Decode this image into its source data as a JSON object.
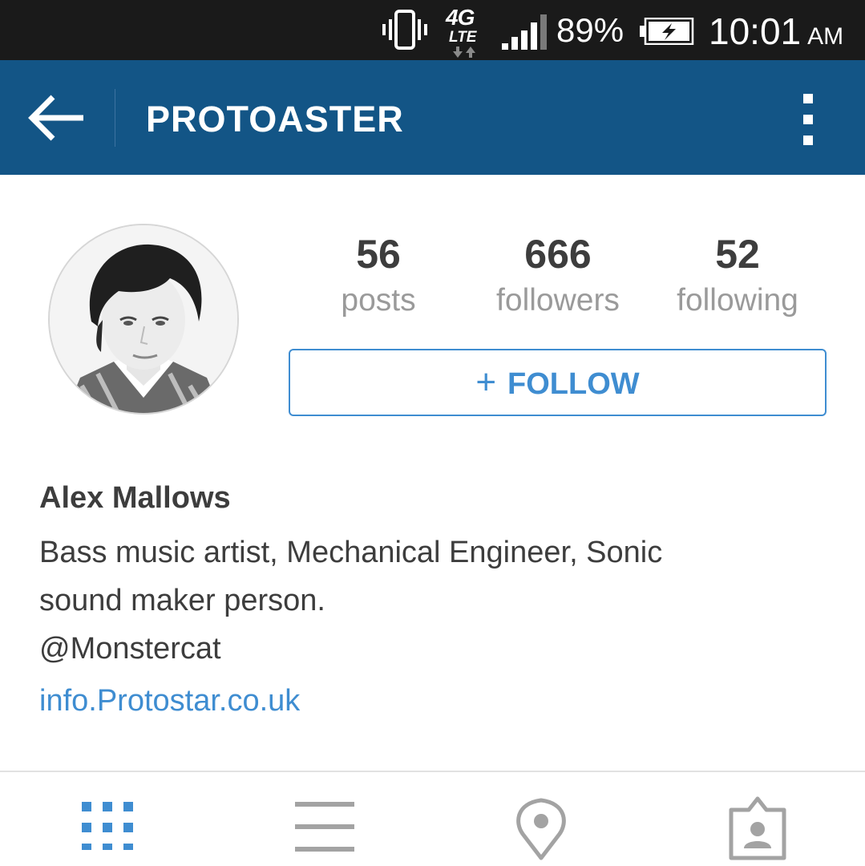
{
  "status_bar": {
    "network_top": "4G",
    "network_bottom": "LTE",
    "battery_percent": "89%",
    "time": "10:01",
    "ampm": "AM",
    "icons": [
      "vibrate-icon",
      "network-arrows-icon",
      "signal-icon",
      "battery-charging-icon"
    ]
  },
  "app_bar": {
    "title": "PROTOASTER",
    "back_icon": "arrow-left-icon",
    "menu_icon": "overflow-menu-icon",
    "background": "#135586"
  },
  "profile": {
    "avatar_icon": "profile-photo",
    "stats": [
      {
        "value": "56",
        "label": "posts"
      },
      {
        "value": "666",
        "label": "followers"
      },
      {
        "value": "52",
        "label": "following"
      }
    ],
    "follow_button": {
      "plus": "+",
      "label": "FOLLOW"
    },
    "name": "Alex Mallows",
    "bio_lines": [
      "Bass music artist, Mechanical Engineer, Sonic",
      "sound maker person.",
      "@Monstercat"
    ],
    "link": "info.Protostar.co.uk"
  },
  "tabs": [
    {
      "icon": "grid-view-icon",
      "active": true
    },
    {
      "icon": "list-view-icon",
      "active": false
    },
    {
      "icon": "location-pin-icon",
      "active": false
    },
    {
      "icon": "tagged-photos-icon",
      "active": false
    }
  ],
  "colors": {
    "accent": "#3f8dd1",
    "status_bar": "#1a1a1a",
    "text_dark": "#3d3d3d",
    "text_muted": "#9a9a9a",
    "icon_inactive": "#a3a3a3"
  }
}
